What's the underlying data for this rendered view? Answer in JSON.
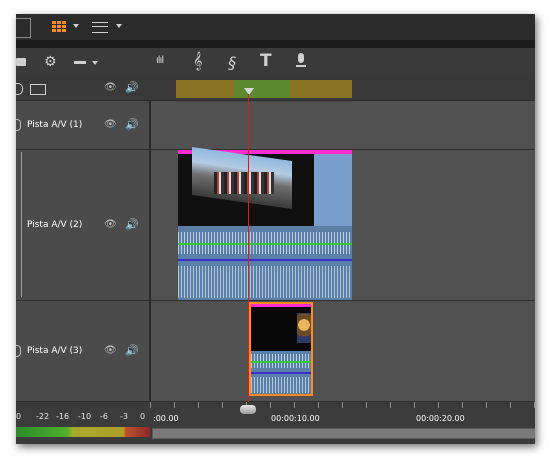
{
  "header": {
    "view_buttons": [
      "grid-view-icon",
      "list-view-icon"
    ],
    "accent": "#ff8c1a"
  },
  "toolbar": {
    "tools": [
      {
        "name": "audio-levels-icon",
        "glyph": "ılıl"
      },
      {
        "name": "music-icon",
        "glyph": "𝄞"
      },
      {
        "name": "sound-effect-icon",
        "glyph": "§"
      },
      {
        "name": "title-icon",
        "glyph": "T"
      },
      {
        "name": "microphone-icon",
        "glyph": "🎙"
      }
    ]
  },
  "tracks": [
    {
      "name": "Pista A/V (1)"
    },
    {
      "name": "Pista A/V (2)"
    },
    {
      "name": "Pista A/V (3)"
    }
  ],
  "meter": {
    "labels": [
      "0",
      "-22",
      "-16",
      "-10",
      "-6",
      "-3",
      "0"
    ]
  },
  "timeline": {
    "time_labels": [
      ":00.00",
      "00:00:10.00",
      "00:00:20.00"
    ]
  },
  "colors": {
    "playhead": "#d21f1f",
    "clip_top_bar": "#ff2bd0",
    "clip_selected_border": "#ff8c1a",
    "audio_waveform": "#bcd6f0",
    "audio_line_green": "#37c837",
    "audio_line_blue": "#3b2ccc",
    "clip_blue": "#7a9fcc",
    "ruler_gold": "#8a7426",
    "ruler_green": "#5d8a2c"
  }
}
